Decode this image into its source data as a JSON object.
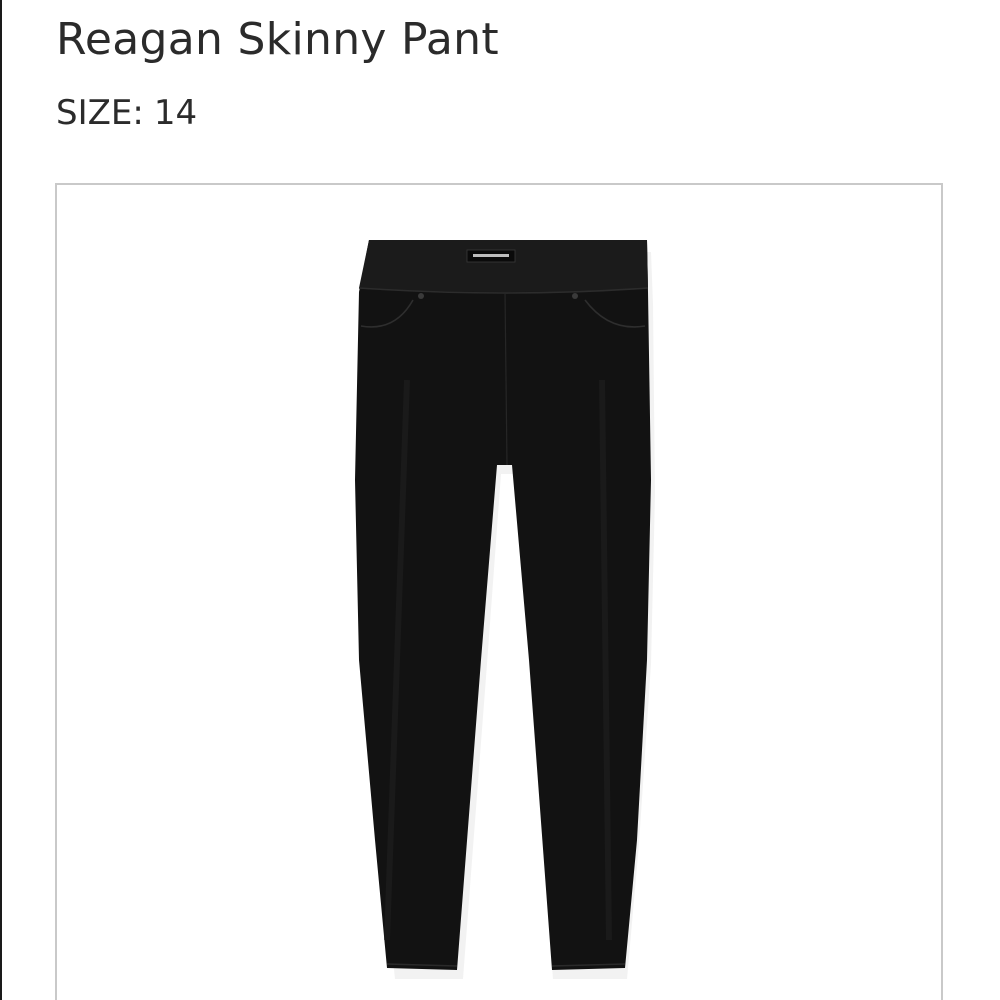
{
  "product": {
    "title": "Reagan Skinny Pant",
    "size_label": "SIZE:",
    "size_value": "14"
  },
  "image": {
    "icon": "black-skinny-pant-image",
    "color": "#111111"
  }
}
